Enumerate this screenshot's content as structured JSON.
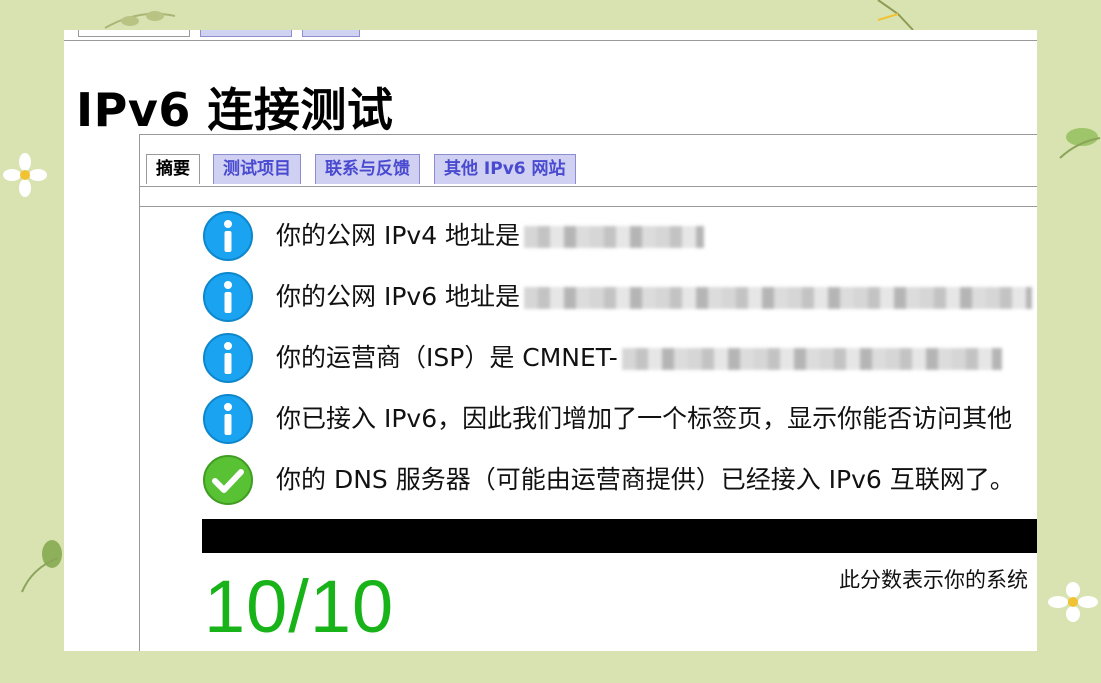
{
  "page_title": "IPv6 连接测试",
  "top_tabs": [
    "",
    "",
    ""
  ],
  "tabs": [
    {
      "label": "摘要",
      "active": true
    },
    {
      "label": "测试项目",
      "active": false
    },
    {
      "label": "联系与反馈",
      "active": false
    },
    {
      "label": "其他 IPv6 网站",
      "active": false
    }
  ],
  "results": [
    {
      "icon": "info-icon",
      "text": "你的公网 IPv4 地址是"
    },
    {
      "icon": "info-icon",
      "text": "你的公网 IPv6 地址是"
    },
    {
      "icon": "info-icon",
      "text": "你的运营商（ISP）是 CMNET-"
    },
    {
      "icon": "info-icon",
      "text": "你已接入 IPv6，因此我们增加了一个标签页，显示你能否访问其他"
    },
    {
      "icon": "check-icon",
      "text": "你的 DNS 服务器（可能由运营商提供）已经接入 IPv6 互联网了。"
    }
  ],
  "score": "10/10",
  "score_description": "此分数表示你的系统",
  "colors": {
    "background": "#d9e3b2",
    "info_icon": "#1aa3f0",
    "check_icon": "#59c234",
    "score": "#18b318",
    "inactive_tab": "#cfd0f2",
    "inactive_tab_text": "#4a4ad0"
  }
}
